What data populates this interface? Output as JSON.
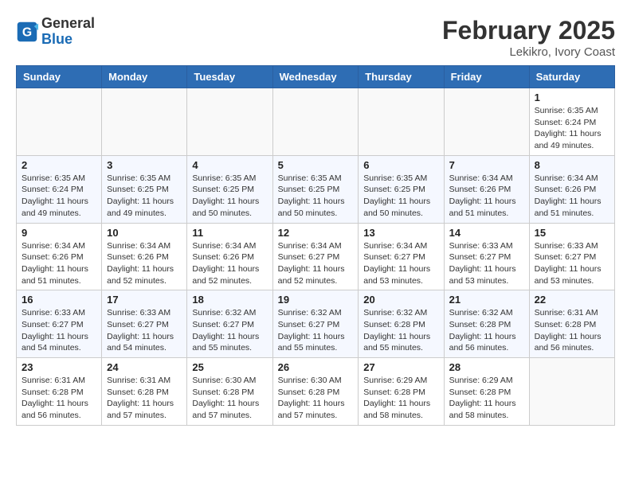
{
  "header": {
    "logo_general": "General",
    "logo_blue": "Blue",
    "month": "February 2025",
    "location": "Lekikro, Ivory Coast"
  },
  "days_of_week": [
    "Sunday",
    "Monday",
    "Tuesday",
    "Wednesday",
    "Thursday",
    "Friday",
    "Saturday"
  ],
  "weeks": [
    [
      {
        "day": "",
        "info": ""
      },
      {
        "day": "",
        "info": ""
      },
      {
        "day": "",
        "info": ""
      },
      {
        "day": "",
        "info": ""
      },
      {
        "day": "",
        "info": ""
      },
      {
        "day": "",
        "info": ""
      },
      {
        "day": "1",
        "info": "Sunrise: 6:35 AM\nSunset: 6:24 PM\nDaylight: 11 hours and 49 minutes."
      }
    ],
    [
      {
        "day": "2",
        "info": "Sunrise: 6:35 AM\nSunset: 6:24 PM\nDaylight: 11 hours and 49 minutes."
      },
      {
        "day": "3",
        "info": "Sunrise: 6:35 AM\nSunset: 6:25 PM\nDaylight: 11 hours and 49 minutes."
      },
      {
        "day": "4",
        "info": "Sunrise: 6:35 AM\nSunset: 6:25 PM\nDaylight: 11 hours and 50 minutes."
      },
      {
        "day": "5",
        "info": "Sunrise: 6:35 AM\nSunset: 6:25 PM\nDaylight: 11 hours and 50 minutes."
      },
      {
        "day": "6",
        "info": "Sunrise: 6:35 AM\nSunset: 6:25 PM\nDaylight: 11 hours and 50 minutes."
      },
      {
        "day": "7",
        "info": "Sunrise: 6:34 AM\nSunset: 6:26 PM\nDaylight: 11 hours and 51 minutes."
      },
      {
        "day": "8",
        "info": "Sunrise: 6:34 AM\nSunset: 6:26 PM\nDaylight: 11 hours and 51 minutes."
      }
    ],
    [
      {
        "day": "9",
        "info": "Sunrise: 6:34 AM\nSunset: 6:26 PM\nDaylight: 11 hours and 51 minutes."
      },
      {
        "day": "10",
        "info": "Sunrise: 6:34 AM\nSunset: 6:26 PM\nDaylight: 11 hours and 52 minutes."
      },
      {
        "day": "11",
        "info": "Sunrise: 6:34 AM\nSunset: 6:26 PM\nDaylight: 11 hours and 52 minutes."
      },
      {
        "day": "12",
        "info": "Sunrise: 6:34 AM\nSunset: 6:27 PM\nDaylight: 11 hours and 52 minutes."
      },
      {
        "day": "13",
        "info": "Sunrise: 6:34 AM\nSunset: 6:27 PM\nDaylight: 11 hours and 53 minutes."
      },
      {
        "day": "14",
        "info": "Sunrise: 6:33 AM\nSunset: 6:27 PM\nDaylight: 11 hours and 53 minutes."
      },
      {
        "day": "15",
        "info": "Sunrise: 6:33 AM\nSunset: 6:27 PM\nDaylight: 11 hours and 53 minutes."
      }
    ],
    [
      {
        "day": "16",
        "info": "Sunrise: 6:33 AM\nSunset: 6:27 PM\nDaylight: 11 hours and 54 minutes."
      },
      {
        "day": "17",
        "info": "Sunrise: 6:33 AM\nSunset: 6:27 PM\nDaylight: 11 hours and 54 minutes."
      },
      {
        "day": "18",
        "info": "Sunrise: 6:32 AM\nSunset: 6:27 PM\nDaylight: 11 hours and 55 minutes."
      },
      {
        "day": "19",
        "info": "Sunrise: 6:32 AM\nSunset: 6:27 PM\nDaylight: 11 hours and 55 minutes."
      },
      {
        "day": "20",
        "info": "Sunrise: 6:32 AM\nSunset: 6:28 PM\nDaylight: 11 hours and 55 minutes."
      },
      {
        "day": "21",
        "info": "Sunrise: 6:32 AM\nSunset: 6:28 PM\nDaylight: 11 hours and 56 minutes."
      },
      {
        "day": "22",
        "info": "Sunrise: 6:31 AM\nSunset: 6:28 PM\nDaylight: 11 hours and 56 minutes."
      }
    ],
    [
      {
        "day": "23",
        "info": "Sunrise: 6:31 AM\nSunset: 6:28 PM\nDaylight: 11 hours and 56 minutes."
      },
      {
        "day": "24",
        "info": "Sunrise: 6:31 AM\nSunset: 6:28 PM\nDaylight: 11 hours and 57 minutes."
      },
      {
        "day": "25",
        "info": "Sunrise: 6:30 AM\nSunset: 6:28 PM\nDaylight: 11 hours and 57 minutes."
      },
      {
        "day": "26",
        "info": "Sunrise: 6:30 AM\nSunset: 6:28 PM\nDaylight: 11 hours and 57 minutes."
      },
      {
        "day": "27",
        "info": "Sunrise: 6:29 AM\nSunset: 6:28 PM\nDaylight: 11 hours and 58 minutes."
      },
      {
        "day": "28",
        "info": "Sunrise: 6:29 AM\nSunset: 6:28 PM\nDaylight: 11 hours and 58 minutes."
      },
      {
        "day": "",
        "info": ""
      }
    ]
  ]
}
